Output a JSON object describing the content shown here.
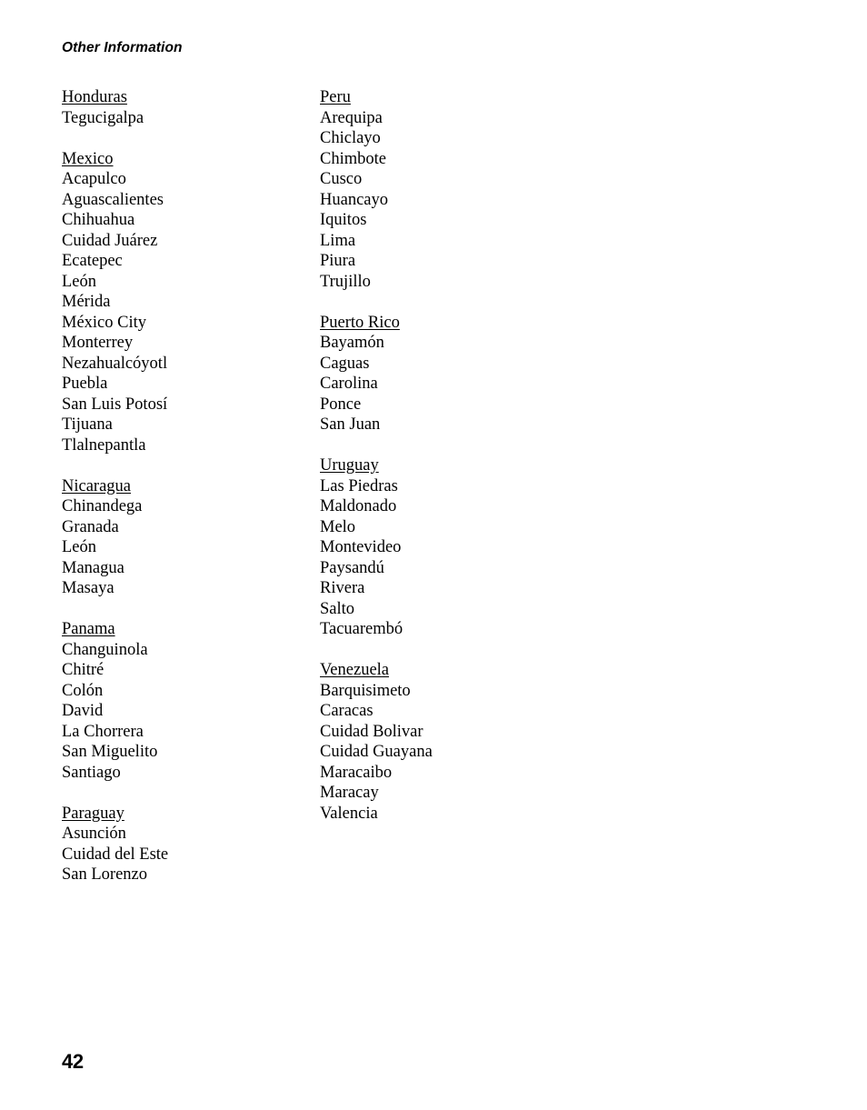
{
  "header": {
    "running_title": "Other Information"
  },
  "footer": {
    "page_number": "42"
  },
  "columns": [
    {
      "id": "left",
      "blocks": [
        {
          "country": "Honduras",
          "cities": [
            "Tegucigalpa"
          ]
        },
        {
          "country": "Mexico",
          "cities": [
            "Acapulco",
            "Aguascalientes",
            "Chihuahua",
            "Cuidad Juárez",
            "Ecatepec",
            "León",
            "Mérida",
            "México City",
            "Monterrey",
            "Nezahualcóyotl",
            "Puebla",
            "San Luis Potosí",
            "Tijuana",
            "Tlalnepantla"
          ]
        },
        {
          "country": "Nicaragua",
          "cities": [
            "Chinandega",
            "Granada",
            "León",
            "Managua",
            "Masaya"
          ]
        },
        {
          "country": "Panama",
          "cities": [
            "Changuinola",
            "Chitré",
            "Colón",
            "David",
            "La Chorrera",
            "San Miguelito",
            "Santiago"
          ]
        },
        {
          "country": "Paraguay",
          "cities": [
            "Asunción",
            "Cuidad del Este",
            "San Lorenzo"
          ]
        }
      ]
    },
    {
      "id": "right",
      "blocks": [
        {
          "country": "Peru",
          "cities": [
            "Arequipa",
            "Chiclayo",
            "Chimbote",
            "Cusco",
            "Huancayo",
            "Iquitos",
            "Lima",
            "Piura",
            "Trujillo"
          ]
        },
        {
          "country": "Puerto Rico",
          "cities": [
            "Bayamón",
            "Caguas",
            "Carolina",
            "Ponce",
            "San Juan"
          ]
        },
        {
          "country": "Uruguay",
          "cities": [
            "Las Piedras",
            "Maldonado",
            "Melo",
            "Montevideo",
            "Paysandú",
            "Rivera",
            "Salto",
            "Tacuarembó"
          ]
        },
        {
          "country": "Venezuela",
          "cities": [
            "Barquisimeto",
            "Caracas",
            "Cuidad Bolivar",
            "Cuidad Guayana",
            "Maracaibo",
            "Maracay",
            "Valencia"
          ]
        }
      ]
    }
  ]
}
